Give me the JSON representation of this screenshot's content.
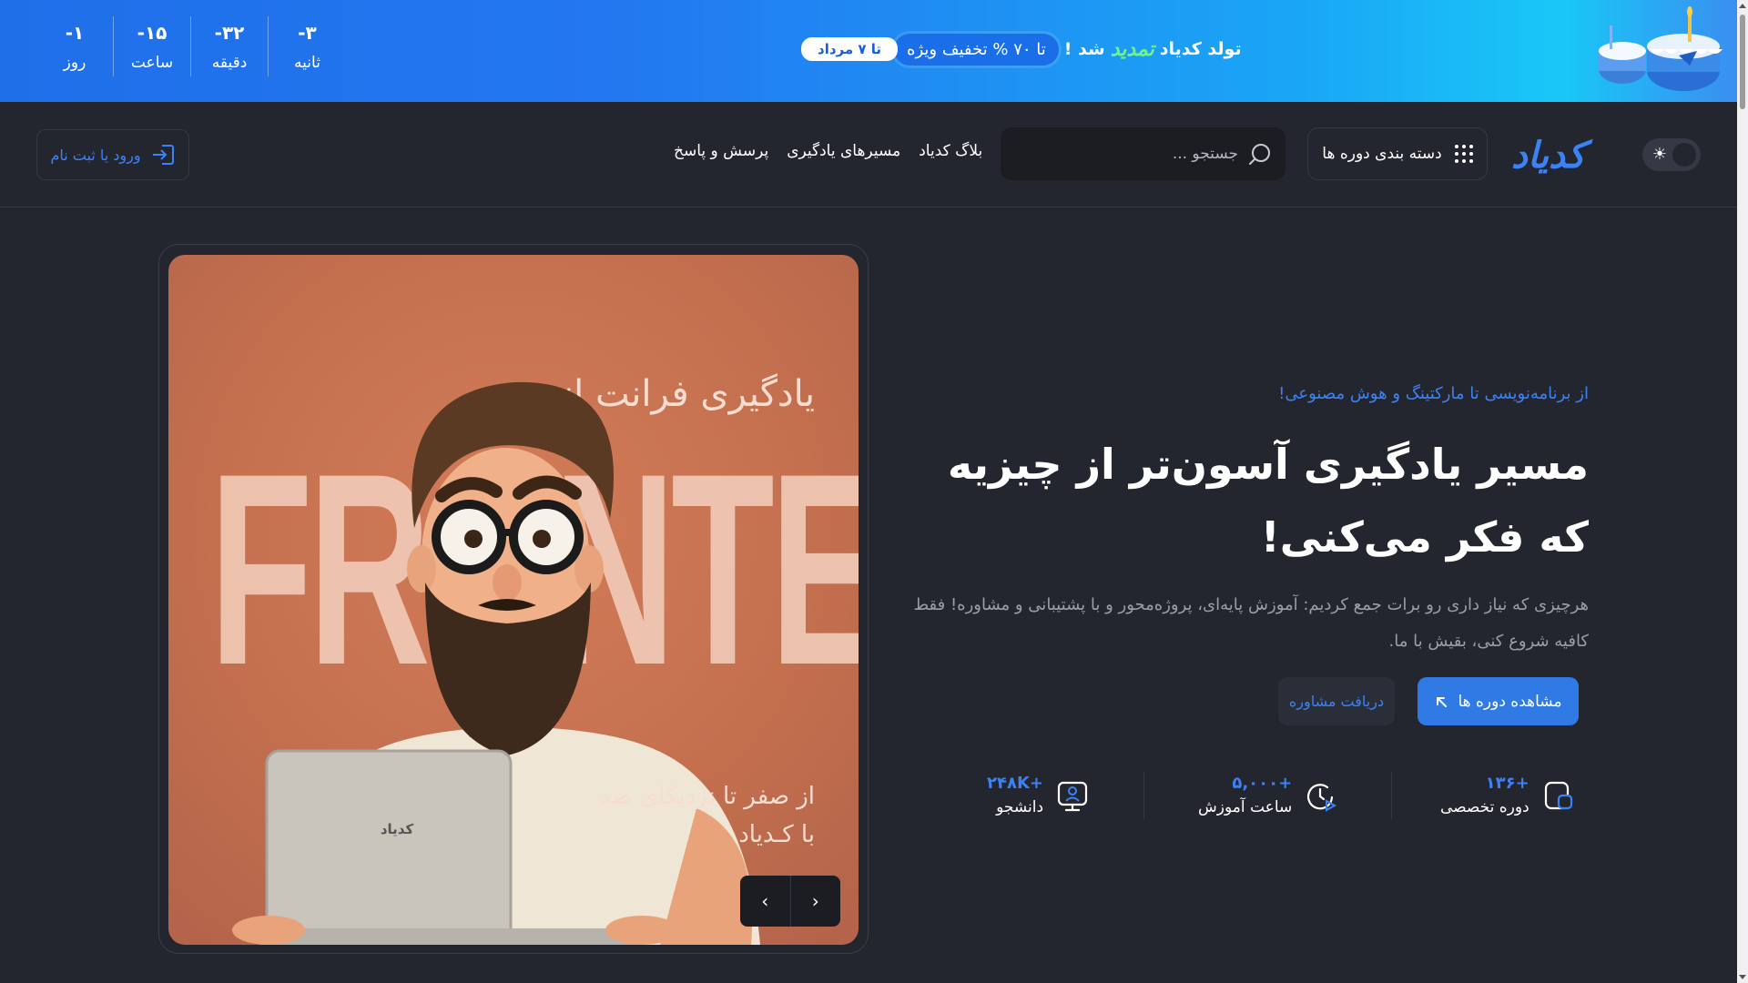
{
  "banner": {
    "countdown": [
      {
        "value": "-۱",
        "label": "روز"
      },
      {
        "value": "-۱۵",
        "label": "ساعت"
      },
      {
        "value": "-۳۲",
        "label": "دقیقه"
      },
      {
        "value": "-۳",
        "label": "ثانیه"
      }
    ],
    "text_prefix": "تولد کدیاد",
    "text_highlight": "تمدید",
    "text_suffix": "شد !",
    "discount_pill": "تا ۷۰ % تخفیف ویژه",
    "date_badge": "تا ۷ مرداد"
  },
  "header": {
    "logo": "کدیاد",
    "categories_label": "دسته بندی دوره ها",
    "search_placeholder": "جستجو ...",
    "nav": [
      "بلاگ کدیاد",
      "مسیرهای یادگیری",
      "پرسش و پاسخ"
    ],
    "login_label": "ورود یا ثبت نام"
  },
  "hero": {
    "tagline": "از برنامه‌نویسی تا مارکتینگ و هوش مصنوعی!",
    "title": "مسیر یادگیری آسون‌تر از چیزیه که فکر می‌کنی!",
    "description": "هرچیزی که نیاز داری رو برات جمع کردیم: آموزش پایه‌ای، پروژه‌محور و با پشتیبانی و مشاوره! فقط کافیه شروع کنی، بقیش با ما.",
    "primary_button": "مشاهده دوره ها",
    "secondary_button": "دریافت مشاوره"
  },
  "stats": [
    {
      "value": "+۱۳۶",
      "label": "دوره تخصصی",
      "icon": "course-icon"
    },
    {
      "value": "+۵,۰۰۰",
      "label": "ساعت آموزش",
      "icon": "clock-play-icon"
    },
    {
      "value": "+۲۴۸K",
      "label": "دانشجو",
      "icon": "student-icon"
    }
  ],
  "slide": {
    "background_word": "FRONTEND",
    "title": "یادگیری فرانت اند",
    "sub1": "از صفر تا نزدیکای صد",
    "sub2": "با کـدیاد",
    "laptop_logo": "کدیاد"
  },
  "colors": {
    "accent": "#3b82f6",
    "background": "#23262f",
    "slide_bg": "#c4704f"
  }
}
